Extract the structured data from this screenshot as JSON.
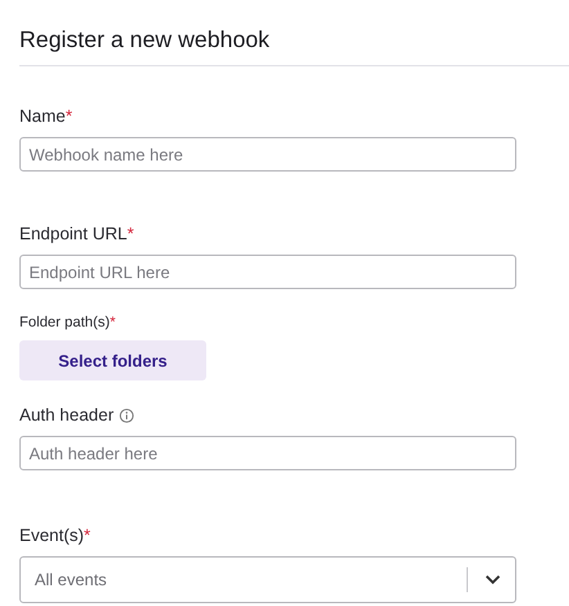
{
  "title": "Register a new webhook",
  "fields": [
    {
      "kind": "text",
      "label": "Name",
      "required_mark": "*",
      "info": false,
      "placeholder": "Webhook name here"
    },
    {
      "kind": "text",
      "label": "Endpoint URL",
      "required_mark": "*",
      "info": false,
      "placeholder": "Endpoint URL here"
    },
    {
      "kind": "folder",
      "label": "Folder path(s)",
      "required_mark": "*",
      "info": false,
      "button": "Select folders"
    },
    {
      "kind": "text",
      "label": "Auth header",
      "info": true,
      "placeholder": "Auth header here"
    },
    {
      "kind": "select",
      "label": "Event(s)",
      "required_mark": "*",
      "info": false,
      "value": "All events"
    }
  ]
}
